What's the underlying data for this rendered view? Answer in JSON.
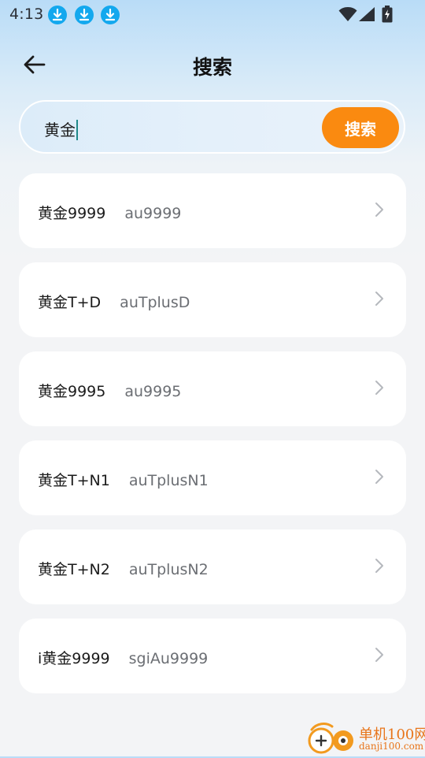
{
  "status_bar": {
    "time": "4:13",
    "download_icons": [
      "download-icon",
      "download-icon",
      "download-icon"
    ],
    "icons": [
      "wifi-icon",
      "cell-signal-icon",
      "battery-charging-icon"
    ]
  },
  "header": {
    "back_icon": "arrow-left-icon",
    "title": "搜索"
  },
  "search": {
    "query": "黄金",
    "button_label": "搜索"
  },
  "results": [
    {
      "name": "黄金9999",
      "code": "au9999"
    },
    {
      "name": "黄金T+D",
      "code": "auTplusD"
    },
    {
      "name": "黄金9995",
      "code": "au9995"
    },
    {
      "name": "黄金T+N1",
      "code": "auTplusN1"
    },
    {
      "name": "黄金T+N2",
      "code": "auTplusN2"
    },
    {
      "name": "i黄金9999",
      "code": "sgiAu9999"
    }
  ],
  "watermark": {
    "title": "单机100网",
    "url": "danji100.com"
  },
  "colors": {
    "accent": "#fa8a10",
    "download_badge": "#13a8ee",
    "caret": "#1f8a8a"
  }
}
